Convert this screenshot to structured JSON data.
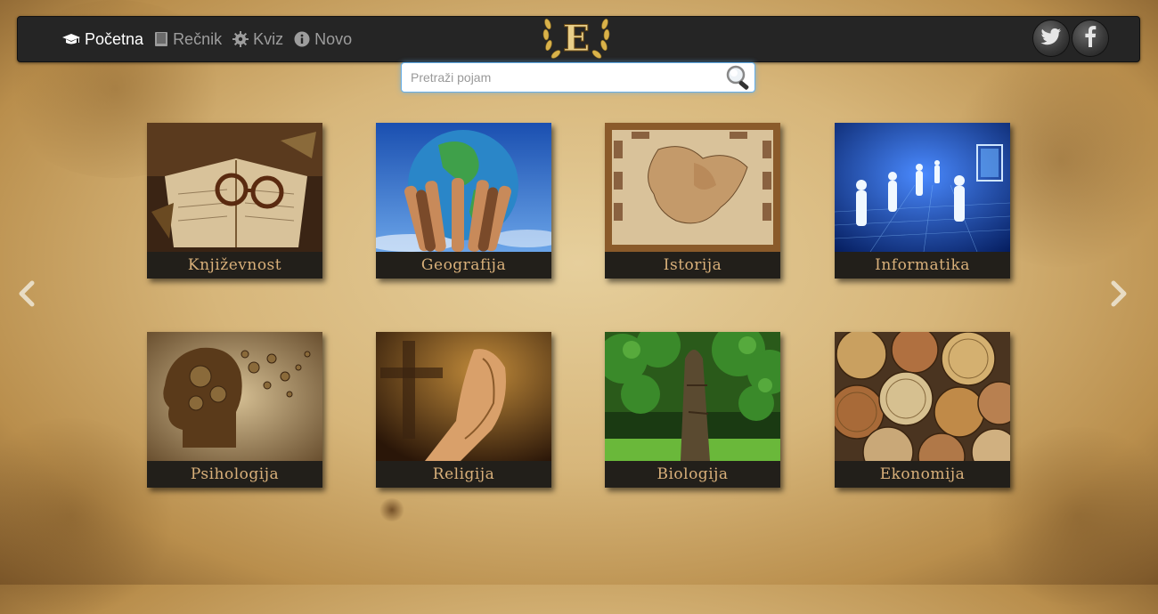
{
  "nav": {
    "items": [
      {
        "label": "Početna",
        "icon": "graduation-cap-icon",
        "active": true
      },
      {
        "label": "Rečnik",
        "icon": "book-icon",
        "active": false
      },
      {
        "label": "Kviz",
        "icon": "gear-icon",
        "active": false
      },
      {
        "label": "Novo",
        "icon": "info-icon",
        "active": false
      }
    ],
    "logo_letter": "E",
    "social": [
      "twitter-icon",
      "facebook-icon"
    ]
  },
  "search": {
    "placeholder": "Pretraži pojam",
    "value": ""
  },
  "categories": [
    {
      "label": "Književnost"
    },
    {
      "label": "Geografija"
    },
    {
      "label": "Istorija"
    },
    {
      "label": "Informatika"
    },
    {
      "label": "Psihologija"
    },
    {
      "label": "Religija"
    },
    {
      "label": "Biologija"
    },
    {
      "label": "Ekonomija"
    }
  ],
  "colors": {
    "navbar": "#252525",
    "caption_text": "#d9b07a",
    "active_nav": "#ffffff",
    "inactive_nav": "#9d9d9d"
  }
}
